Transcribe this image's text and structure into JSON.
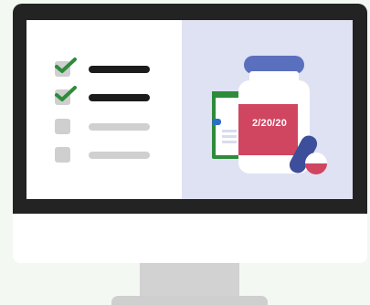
{
  "prescription_bottle": {
    "label_date": "2/20/20"
  },
  "checklist": {
    "items": [
      {
        "checked": true
      },
      {
        "checked": true
      },
      {
        "checked": false
      },
      {
        "checked": false
      }
    ]
  },
  "colors": {
    "page_background": "#f3f8f3",
    "bezel": "#232323",
    "screen_left": "#ffffff",
    "screen_right": "#dfe2f2",
    "check_green": "#2e8b3a",
    "bottle_label": "#d04560",
    "bottle_cap": "#5a6fbe",
    "pill_blue": "#3d4f9a"
  }
}
